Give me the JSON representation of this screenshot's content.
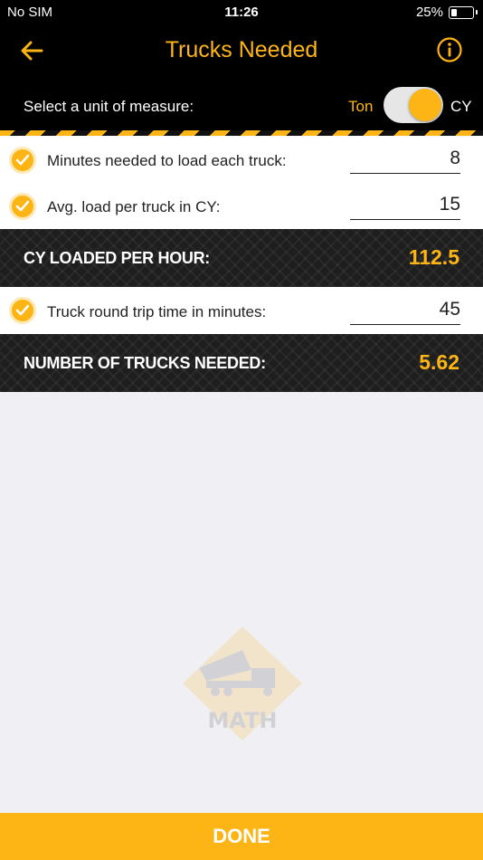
{
  "status_bar": {
    "carrier": "No SIM",
    "time": "11:26",
    "battery": "25%"
  },
  "nav": {
    "title": "Trucks Needed",
    "back_icon": "back-arrow-icon",
    "info_icon": "info-icon"
  },
  "unit": {
    "label": "Select a unit of measure:",
    "option_ton": "Ton",
    "option_cy": "CY",
    "selected": "CY"
  },
  "inputs": [
    {
      "label": "Minutes needed to load each truck:",
      "value": "8"
    },
    {
      "label": "Avg. load per truck in CY:",
      "value": "15"
    },
    {
      "label": "Truck round trip time in minutes:",
      "value": "45"
    }
  ],
  "results": [
    {
      "label": "CY LOADED PER HOUR:",
      "value": "112.5"
    },
    {
      "label": "NUMBER OF TRUCKS NEEDED:",
      "value": "5.62"
    }
  ],
  "watermark_text": "MATH",
  "done_label": "DONE",
  "colors": {
    "accent": "#fdb515",
    "bar_bg": "#000000",
    "page_bg": "#efeff4"
  }
}
